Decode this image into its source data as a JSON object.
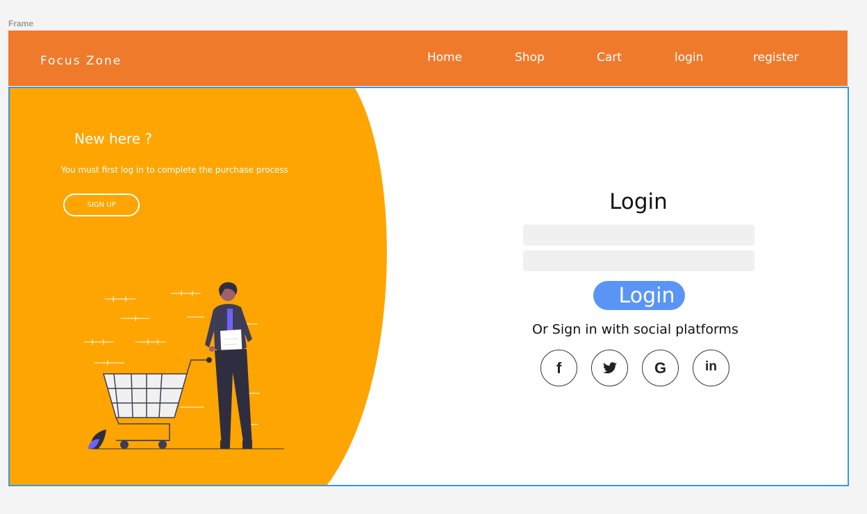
{
  "frame": {
    "label": "Frame"
  },
  "header": {
    "brand": "Focus Zone",
    "nav": [
      "Home",
      "Shop",
      "Cart",
      "login",
      "register"
    ]
  },
  "welcome": {
    "title": "New here ?",
    "text": "You must first log in to complete the purchase process",
    "signup_label": "SIGN UP"
  },
  "login": {
    "title": "Login",
    "username": {
      "value": "",
      "placeholder": ""
    },
    "password": {
      "value": "",
      "placeholder": ""
    },
    "button_label": "Login",
    "social_text": "Or Sign in with social platforms",
    "social": [
      {
        "icon": "facebook-icon",
        "glyph": "f"
      },
      {
        "icon": "twitter-icon",
        "glyph": ""
      },
      {
        "icon": "google-icon",
        "glyph": "G"
      },
      {
        "icon": "linkedin-icon",
        "glyph": "in"
      }
    ]
  },
  "colors": {
    "header": "#ef7a2c",
    "panel": "#fea501",
    "button": "#5a95f5",
    "frame_border": "#2d9be8"
  }
}
